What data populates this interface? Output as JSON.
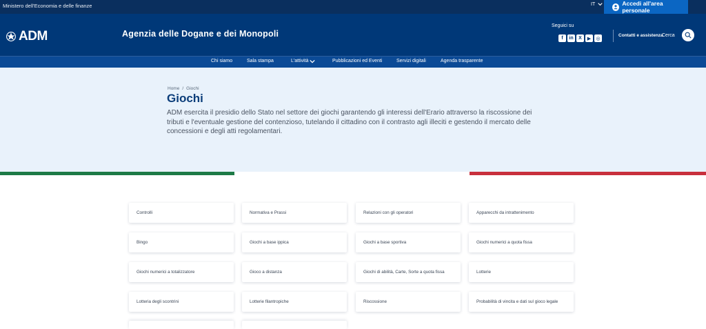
{
  "topbar": {
    "ministry": "Ministero dell'Economia e delle finanze",
    "language": "IT",
    "login_label": "Accedi all'area personale"
  },
  "header": {
    "logo_text": "ADM",
    "agency_name": "Agenzia delle Dogane e dei Monopoli",
    "follow_label": "Seguici su",
    "socials": [
      "facebook-icon",
      "linkedin-icon",
      "x-icon",
      "youtube-icon",
      "instagram-icon"
    ],
    "contacts_label": "Contatti e assistenza",
    "search_label": "Cerca"
  },
  "nav": {
    "items": [
      "Chi siamo",
      "Sala stampa",
      "L'attività",
      "Pubblicazioni ed Eventi",
      "Servizi digitali",
      "Agenda trasparente"
    ]
  },
  "hero": {
    "breadcrumb": [
      "Home",
      "Giochi"
    ],
    "title": "Giochi",
    "description": "ADM esercita il presidio dello Stato nel settore dei giochi garantendo gli interessi dell'Erario attraverso la riscossione dei tributi e l'eventuale gestione del contenzioso, tutelando il cittadino con il contrasto agli illeciti e gestendo il mercato delle concessioni e degli atti regolamentari."
  },
  "colors": {
    "topbar": "#0a2f5e",
    "header": "#003878",
    "nav": "#0b4a96",
    "accent_button": "#0b66c3",
    "hero_bg": "#e9f2fb",
    "title": "#0b3d7a",
    "flag_green": "#1d7a46",
    "flag_red": "#c8303d"
  },
  "cards": [
    "Controlli",
    "Normativa e Prassi",
    "Relazioni con gli operatori",
    "Apparecchi da intrattenimento",
    "Bingo",
    "Giochi a base ippica",
    "Giochi a base sportiva",
    "Giochi numerici a quota fissa",
    "Giochi numerici a totalizzatore",
    "Gioco a distanza",
    "Giochi di abilità, Carte, Sorte a quota fissa",
    "Lotterie",
    "Lotteria degli scontrini",
    "Lotterie filantropiche",
    "Riscossione",
    "Probabilità di vincita e dati sul gioco legale"
  ]
}
